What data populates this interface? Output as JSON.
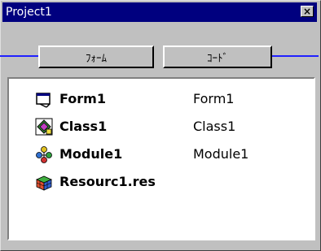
{
  "window": {
    "title": "Project1",
    "close_glyph": "×"
  },
  "toolbar": {
    "form_button_label": "ﾌｫｰﾑ",
    "code_button_label": "ｺｰﾄﾞ"
  },
  "items": [
    {
      "name": "Form1",
      "type": "Form1",
      "icon": "form-icon"
    },
    {
      "name": "Class1",
      "type": "Class1",
      "icon": "class-module-icon"
    },
    {
      "name": "Module1",
      "type": "Module1",
      "icon": "standard-module-icon"
    },
    {
      "name": "Resourc1.res",
      "type": "",
      "icon": "resource-file-icon"
    }
  ],
  "colors": {
    "title_bar": "#00007f",
    "connector_line": "#2020ff",
    "window_face": "#c0c0c0"
  }
}
